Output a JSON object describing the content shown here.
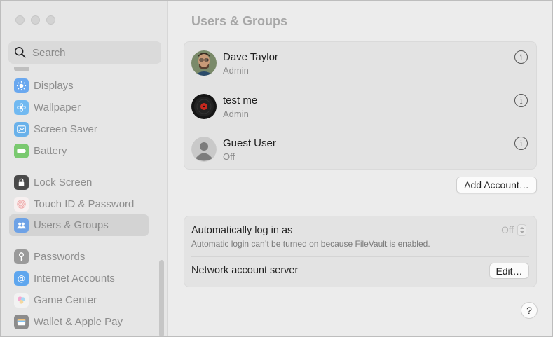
{
  "window": {
    "title": "Users & Groups"
  },
  "search": {
    "placeholder": "Search"
  },
  "sidebar": {
    "items": [
      {
        "label": "Displays",
        "icon": "displays-icon",
        "color": "#6aa8ef"
      },
      {
        "label": "Wallpaper",
        "icon": "wallpaper-icon",
        "color": "#71b9f1"
      },
      {
        "label": "Screen Saver",
        "icon": "screen-saver-icon",
        "color": "#69b1ea"
      },
      {
        "label": "Battery",
        "icon": "battery-icon",
        "color": "#7ac970"
      },
      {
        "label": "Lock Screen",
        "icon": "lock-icon",
        "color": "#4a4a4a"
      },
      {
        "label": "Touch ID & Password",
        "icon": "fingerprint-icon",
        "color": "#f0a8a8"
      },
      {
        "label": "Users & Groups",
        "icon": "users-icon",
        "color": "#6ea2e6",
        "selected": true
      },
      {
        "label": "Passwords",
        "icon": "key-icon",
        "color": "#9a9a9a"
      },
      {
        "label": "Internet Accounts",
        "icon": "at-icon",
        "color": "#5ea6ee"
      },
      {
        "label": "Game Center",
        "icon": "game-center-icon",
        "color": "#f4a8d0"
      },
      {
        "label": "Wallet & Apple Pay",
        "icon": "wallet-icon",
        "color": "#8c8c8c"
      }
    ]
  },
  "users": [
    {
      "name": "Dave Taylor",
      "role": "Admin",
      "avatar": "photo-avatar"
    },
    {
      "name": "test me",
      "role": "Admin",
      "avatar": "record-avatar"
    },
    {
      "name": "Guest User",
      "role": "Off",
      "avatar": "guest-avatar"
    }
  ],
  "buttons": {
    "add_account": "Add Account…",
    "edit": "Edit…",
    "help": "?",
    "info": "i"
  },
  "login": {
    "auto_title": "Automatically log in as",
    "auto_note": "Automatic login can’t be turned on because FileVault is enabled.",
    "auto_value": "Off",
    "network_title": "Network account server"
  }
}
